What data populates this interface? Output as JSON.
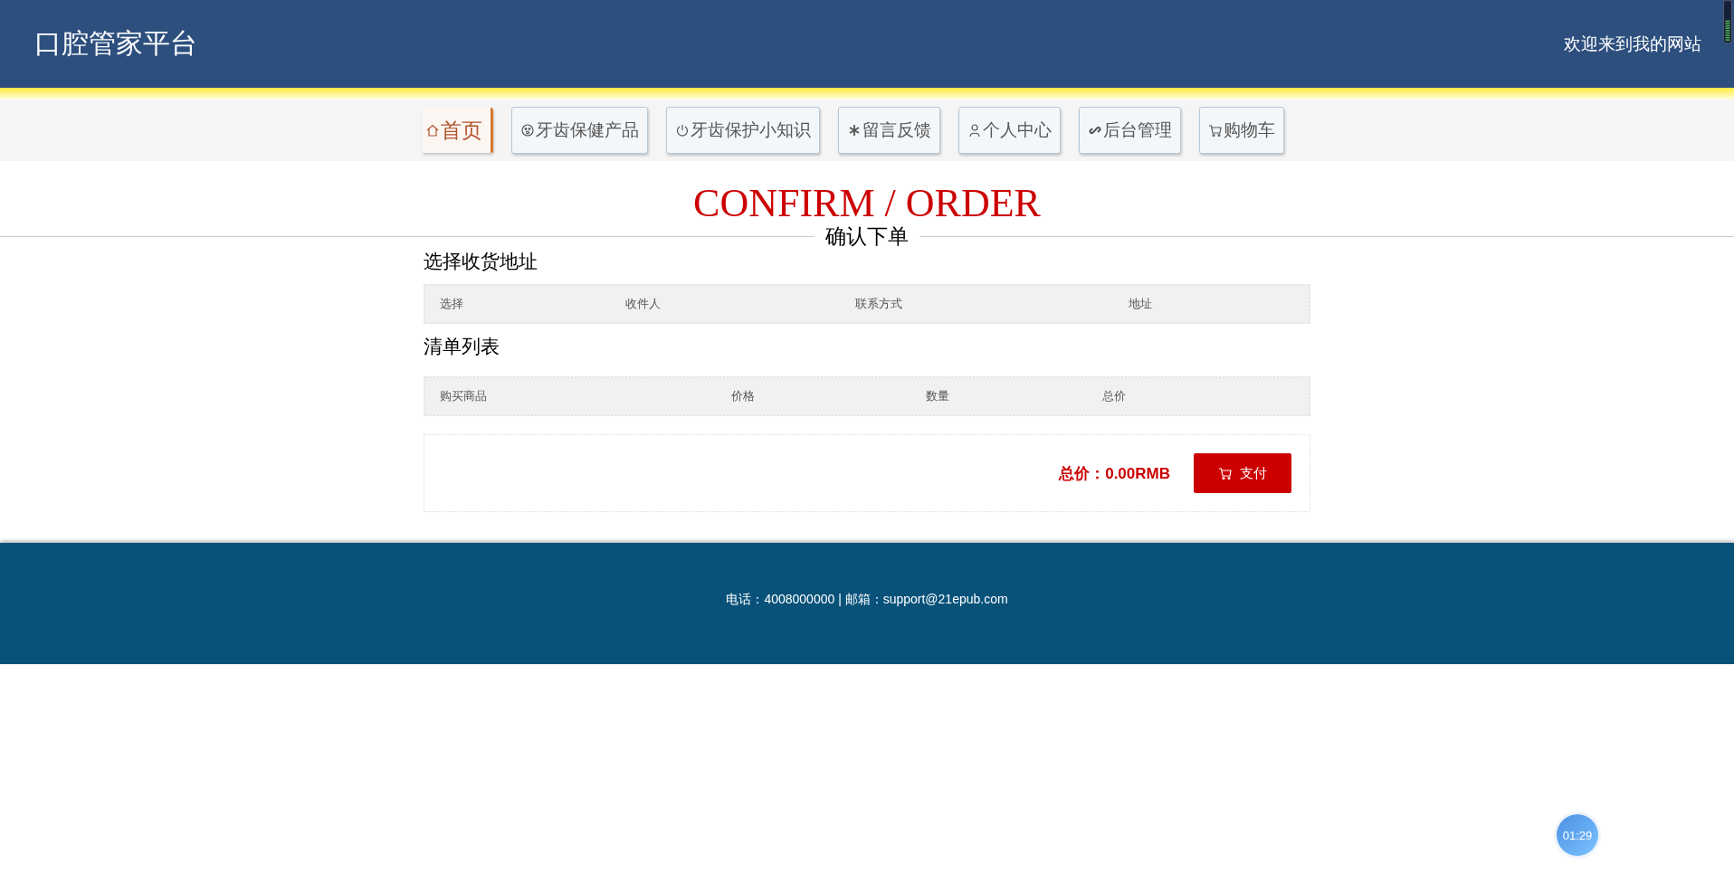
{
  "header": {
    "brand": "口腔管家平台",
    "welcome": "欢迎来到我的网站"
  },
  "nav": [
    {
      "label": "首页",
      "selected": true
    },
    {
      "label": "牙齿保健产品",
      "selected": false
    },
    {
      "label": "牙齿保护小知识",
      "selected": false
    },
    {
      "label": "留言反馈",
      "selected": false
    },
    {
      "label": "个人中心",
      "selected": false
    },
    {
      "label": "后台管理",
      "selected": false
    },
    {
      "label": "购物车",
      "selected": false
    }
  ],
  "page_title": {
    "english": "CONFIRM / ORDER",
    "chinese": "确认下单"
  },
  "address_section": {
    "heading": "选择收货地址",
    "columns": [
      "选择",
      "收件人",
      "联系方式",
      "地址"
    ]
  },
  "list_section": {
    "heading": "清单列表",
    "columns": [
      "购买商品",
      "价格",
      "数量",
      "总价"
    ]
  },
  "summary": {
    "total": "总价：0.00RMB",
    "pay_button": "支付"
  },
  "footer": {
    "contact": "电话：4008000000 | 邮箱：support@21epub.com"
  },
  "timer": "01:29"
}
